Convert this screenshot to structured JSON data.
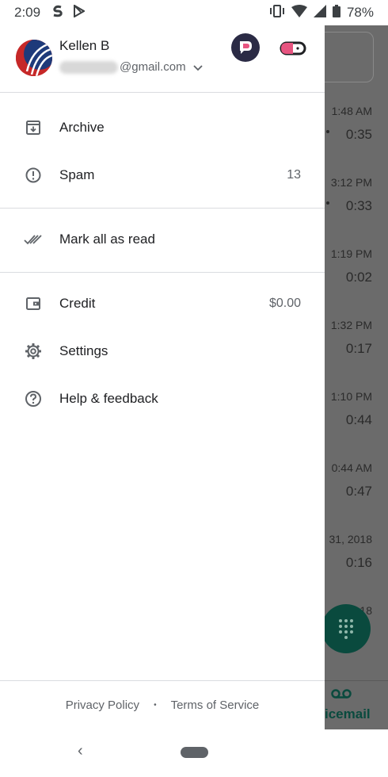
{
  "status_bar": {
    "time": "2:09",
    "battery": "78%",
    "icons": [
      "s-app-icon",
      "play-store-icon",
      "vibrate-icon",
      "wifi-icon",
      "signal-icon",
      "battery-icon"
    ]
  },
  "account": {
    "name": "Kellen B",
    "email_suffix": "@gmail.com"
  },
  "menu": {
    "archive": "Archive",
    "spam": "Spam",
    "spam_count": "13",
    "mark_all_read": "Mark all as read",
    "credit": "Credit",
    "credit_value": "$0.00",
    "settings": "Settings",
    "help": "Help & feedback"
  },
  "footer": {
    "privacy": "Privacy Policy",
    "separator": "•",
    "terms": "Terms of Service"
  },
  "background_list": {
    "rows": [
      {
        "time": "1:48 AM",
        "duration": "0:35"
      },
      {
        "time": "3:12 PM",
        "duration": "0:33"
      },
      {
        "time": "1:19 PM",
        "duration": "0:02"
      },
      {
        "time": "1:32 PM",
        "duration": "0:17"
      },
      {
        "time": "1:10 PM",
        "duration": "0:44"
      },
      {
        "time": "0:44 AM",
        "duration": "0:47"
      },
      {
        "time": "31, 2018",
        "duration": "0:16"
      },
      {
        "time": "18",
        "duration": ""
      }
    ],
    "bottom_label": "icemail"
  },
  "nav": {
    "back": "‹"
  },
  "colors": {
    "accent": "#0a4a3e",
    "scrim": "#6b6b6b",
    "text_primary": "#202124",
    "text_secondary": "#5f6368",
    "divider": "#dadce0"
  }
}
